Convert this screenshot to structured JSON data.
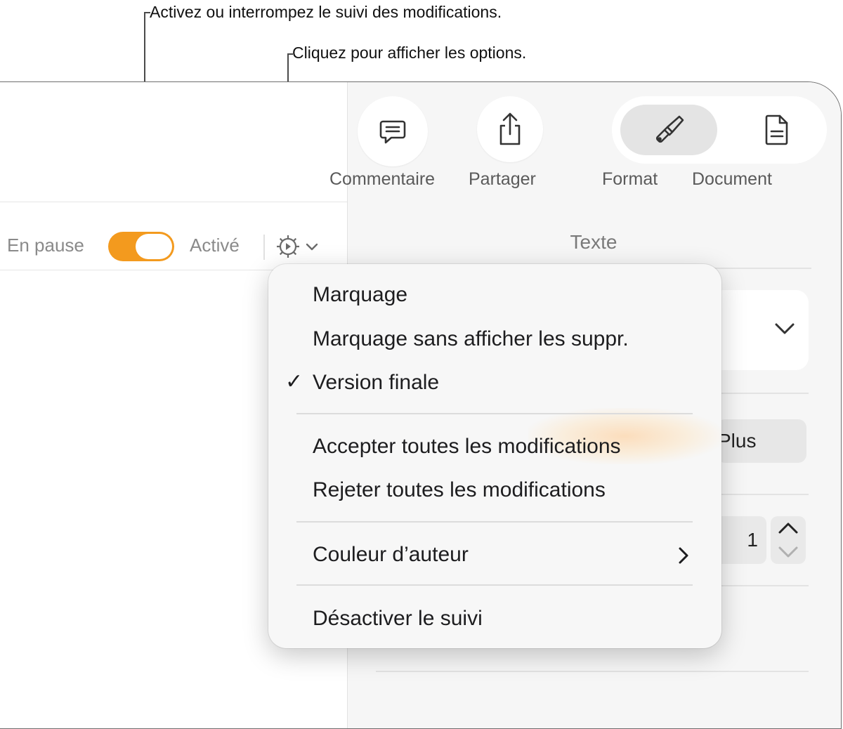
{
  "callouts": {
    "toggle_tracking": "Activez ou interrompez le suivi des modifications.",
    "options": "Cliquez pour afficher les options."
  },
  "toolbar": {
    "comment_label": "Commentaire",
    "share_label": "Partager",
    "format_label": "Format",
    "document_label": "Document"
  },
  "tracking": {
    "paused_label": "En pause",
    "active_label": "Activé",
    "toggle_on": true,
    "toggle_color": "#f39a1e"
  },
  "sidebar": {
    "section_title": "Texte",
    "more_button": "Plus",
    "stepper_value": "1"
  },
  "menu": {
    "items": [
      "Marquage",
      "Marquage sans afficher les suppr.",
      "Version finale",
      "Accepter toutes les modifications",
      "Rejeter toutes les modifications",
      "Couleur d’auteur",
      "Désactiver le suivi"
    ],
    "checked": "Version finale",
    "highlight_color": "#ffd3a0"
  }
}
